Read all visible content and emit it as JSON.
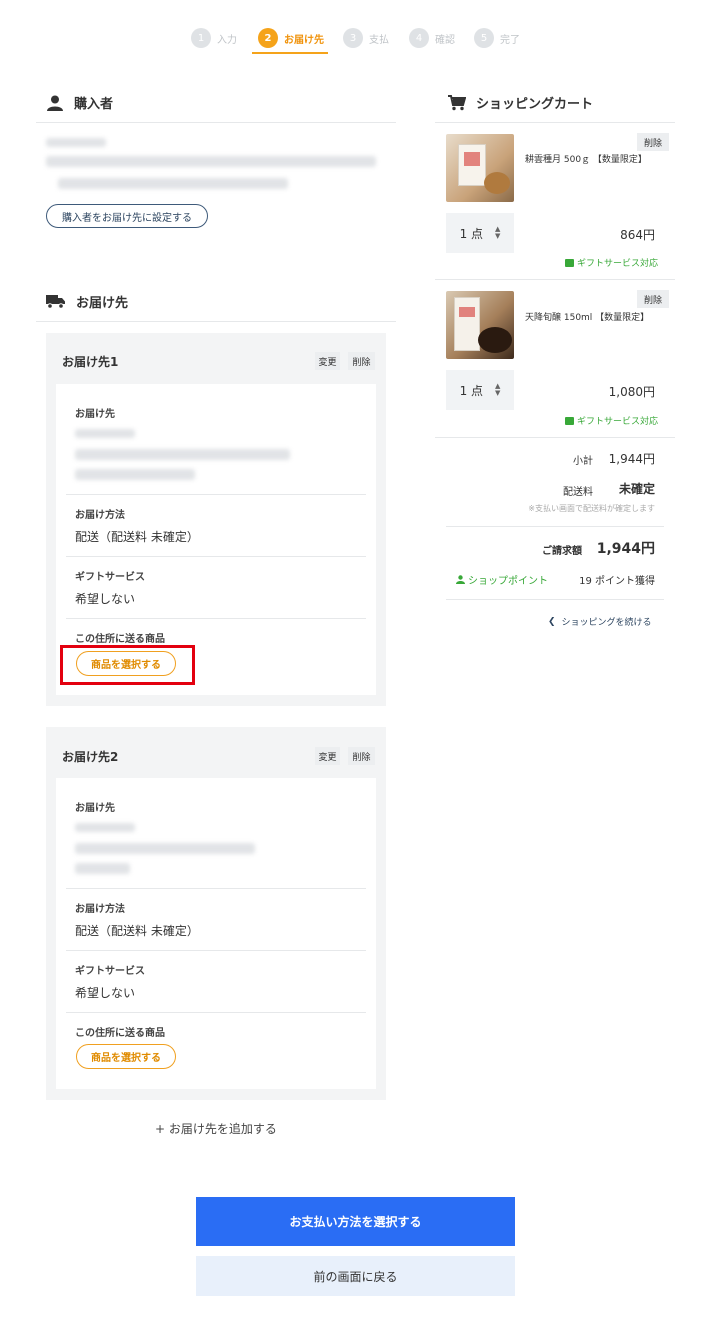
{
  "stepper": {
    "steps": [
      {
        "num": "1",
        "label": "入力"
      },
      {
        "num": "2",
        "label": "お届け先"
      },
      {
        "num": "3",
        "label": "支払"
      },
      {
        "num": "4",
        "label": "確認"
      },
      {
        "num": "5",
        "label": "完了"
      }
    ],
    "active_step": 2
  },
  "buyer": {
    "heading": "購入者",
    "set_as_destination_label": "購入者をお届け先に設定する"
  },
  "destinations": {
    "heading": "お届け先",
    "items": [
      {
        "title": "お届け先1",
        "edit_label": "変更",
        "delete_label": "削除",
        "address_label": "お届け先",
        "method_label": "お届け方法",
        "method_value": "配送（配送料 未確定）",
        "gift_label": "ギフトサービス",
        "gift_value": "希望しない",
        "products_label": "この住所に送る商品",
        "select_products_label": "商品を選択する"
      },
      {
        "title": "お届け先2",
        "edit_label": "変更",
        "delete_label": "削除",
        "address_label": "お届け先",
        "method_label": "お届け方法",
        "method_value": "配送（配送料 未確定）",
        "gift_label": "ギフトサービス",
        "gift_value": "希望しない",
        "products_label": "この住所に送る商品",
        "select_products_label": "商品を選択する"
      }
    ],
    "add_label": "+ お届け先を追加する"
  },
  "cart": {
    "heading": "ショッピングカート",
    "items": [
      {
        "name": "耕雲種月 500ｇ 【数量限定】",
        "delete_label": "削除",
        "qty": "1 点",
        "price": "864円",
        "gift_label": "ギフトサービス対応"
      },
      {
        "name": "天降旬醸 150ml 【数量限定】",
        "delete_label": "削除",
        "qty": "1 点",
        "price": "1,080円",
        "gift_label": "ギフトサービス対応"
      }
    ],
    "subtotal_label": "小計",
    "subtotal_value": "1,944円",
    "shipping_label": "配送料",
    "shipping_value": "未確定",
    "shipping_note": "※支払い画面で配送料が確定します",
    "total_label": "ご請求額",
    "total_value": "1,944円",
    "points_label": "ショップポイント",
    "points_value": "19 ポイント獲得",
    "continue_label": "ショッピングを続ける"
  },
  "actions": {
    "primary_label": "お支払い方法を選択する",
    "back_label": "前の画面に戻る"
  },
  "colors": {
    "accent_orange": "#f5a31a",
    "primary_blue": "#2a6df4",
    "highlight_red": "#e3000f",
    "gift_green": "#38a838"
  }
}
